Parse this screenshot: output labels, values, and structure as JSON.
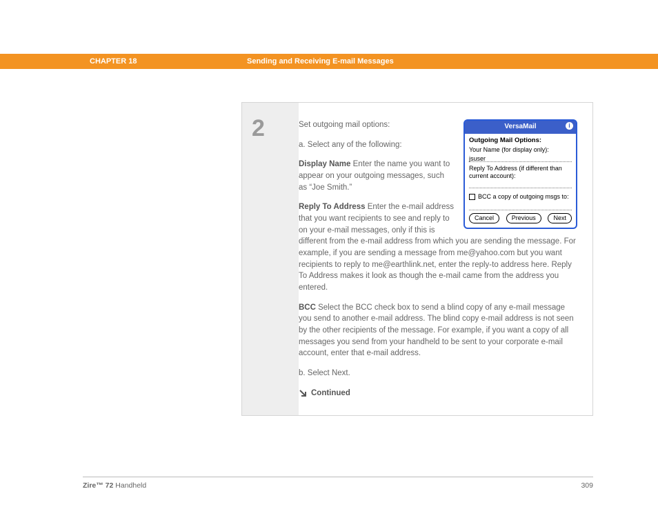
{
  "header": {
    "chapter": "CHAPTER 18",
    "title": "Sending and Receiving E-mail Messages"
  },
  "step": {
    "number": "2",
    "intro": "Set outgoing mail options:",
    "sub_a": "a.  Select any of the following:",
    "display_name_label": "Display Name",
    "display_name_text": "   Enter the name you want to appear on your outgoing messages, such as “Joe Smith.”",
    "reply_to_label": "Reply To Address",
    "reply_to_text": "   Enter the e-mail address that you want recipients to see and reply to on your e-mail messages, only if this is different from the e-mail address from which you are sending the message. For example, if you are sending a message from me@yahoo.com but you want recipients to reply to me@earthlink.net, enter the reply-to address here. Reply To Address makes it look as though the e-mail came from the address you entered.",
    "bcc_label": "BCC",
    "bcc_text": "   Select the BCC check box to send a blind copy of any e-mail message you send to another e-mail address. The blind copy e-mail address is not seen by the other recipients of the message. For example, if you want a copy of all messages you send from your handheld to be sent to your corporate e-mail account, enter that e-mail address.",
    "sub_b": "b.  Select Next.",
    "continued": "Continued"
  },
  "device": {
    "title": "VersaMail",
    "heading": "Outgoing Mail Options:",
    "name_label": "Your Name (for display only):",
    "name_value": "jsuser",
    "reply_label": "Reply To Address (if different than current account):",
    "bcc_label": "BCC a copy of outgoing msgs to:",
    "btn_cancel": "Cancel",
    "btn_prev": "Previous",
    "btn_next": "Next"
  },
  "footer": {
    "product_bold": "Zire™ 72",
    "product_rest": " Handheld",
    "page": "309"
  }
}
